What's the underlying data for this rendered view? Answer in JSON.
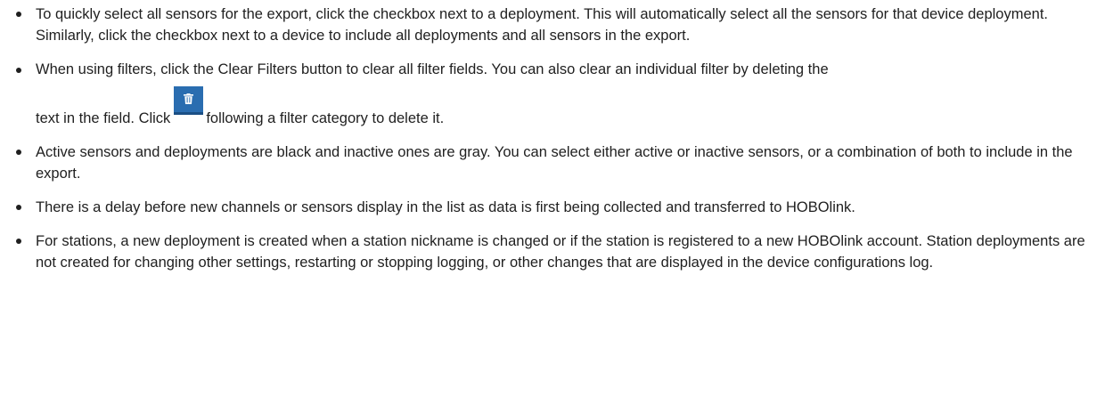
{
  "tips": [
    {
      "text": "To quickly select all sensors for the export, click the checkbox next to a deployment. This will automatically select all the sensors for that device deployment. Similarly, click the checkbox next to a device to include all deployments and all sensors in the export."
    },
    {
      "text_before": "When using filters, click the Clear Filters button to clear all filter fields. You can also clear an individual filter by deleting the",
      "text_mid": "text in the field. Click",
      "icon": "trash-icon",
      "text_after": "following a filter category to delete it."
    },
    {
      "text": "Active sensors and deployments are black and inactive ones are gray. You can select either active or inactive sensors, or a combination of both to include in the export."
    },
    {
      "text": "There is a delay before new channels or sensors display in the list as data is first being collected and transferred to HOBOlink."
    },
    {
      "text": "For stations, a new deployment is created when a station nickname is changed or if the station is registered to a new HOBOlink account. Station deployments are not created for changing other settings, restarting or stopping logging, or other changes that are displayed in the device configurations log."
    }
  ],
  "colors": {
    "text": "#1f1f1f",
    "icon_button": "#2a6db0"
  }
}
